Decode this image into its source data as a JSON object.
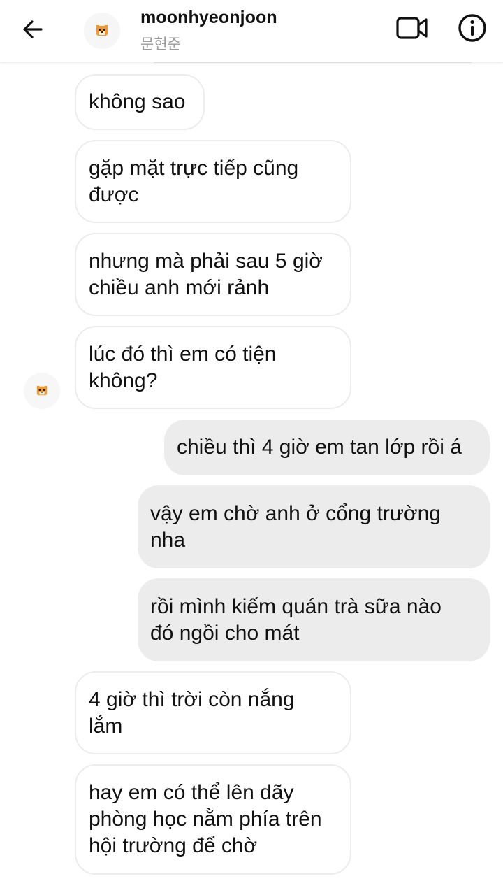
{
  "header": {
    "username": "moonhyeonjoon",
    "subtitle": "문현준"
  },
  "icons": {
    "back": "arrow-left-icon",
    "video": "video-camera-icon",
    "info": "info-icon",
    "avatar": "tiger-avatar-icon"
  },
  "colors": {
    "outgoing_bubble": "#ececec",
    "incoming_border": "#ececec",
    "subtitle_text": "#9a9a9a"
  },
  "messages": [
    {
      "direction": "in",
      "lines": [
        "không sao"
      ]
    },
    {
      "direction": "in",
      "lines": [
        "gặp mặt trực tiếp cũng",
        "được"
      ]
    },
    {
      "direction": "in",
      "lines": [
        "nhưng mà phải sau 5 giờ",
        "chiều anh mới rảnh"
      ]
    },
    {
      "direction": "in",
      "lines": [
        "lúc đó thì em có tiện",
        "không?"
      ]
    },
    {
      "direction": "out",
      "lines": [
        "chiều thì 4 giờ em tan lớp rồi á"
      ]
    },
    {
      "direction": "out",
      "lines": [
        "vậy em chờ anh ở cổng trường",
        "nha"
      ]
    },
    {
      "direction": "out",
      "lines": [
        "rồi mình kiếm quán trà sữa nào",
        "đó ngồi cho mát"
      ]
    },
    {
      "direction": "in",
      "lines": [
        "4 giờ thì trời còn nắng",
        "lắm"
      ]
    },
    {
      "direction": "in",
      "lines": [
        "hay em có thể lên dãy",
        "phòng học nằm phía trên",
        "hội trường để chờ"
      ]
    }
  ]
}
